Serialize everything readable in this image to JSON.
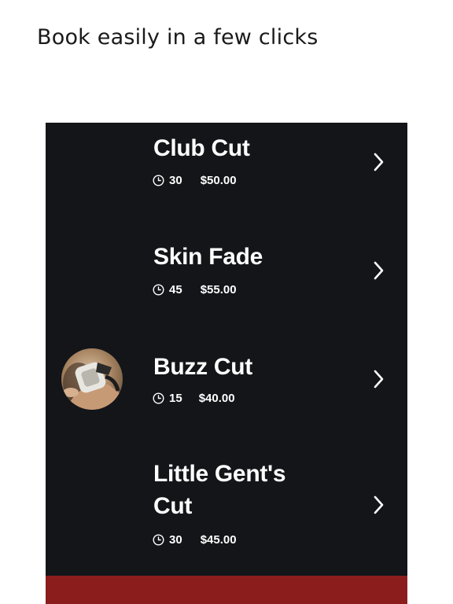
{
  "headline": "Book easily in a few clicks",
  "services": [
    {
      "name": "Club Cut",
      "duration": "30",
      "price": "$50.00"
    },
    {
      "name": "Skin Fade",
      "duration": "45",
      "price": "$55.00"
    },
    {
      "name": "Buzz Cut",
      "duration": "15",
      "price": "$40.00"
    },
    {
      "name_line1": "Little Gent's",
      "name_line2": "Cut",
      "duration": "30",
      "price": "$45.00"
    }
  ],
  "icons": {
    "clock": "clock-icon",
    "chevron": "chevron-right-icon",
    "avatar": "barber-avatar"
  },
  "colors": {
    "background": "#131519",
    "text": "#ffffff",
    "accent_bar": "#8c1d1d"
  }
}
